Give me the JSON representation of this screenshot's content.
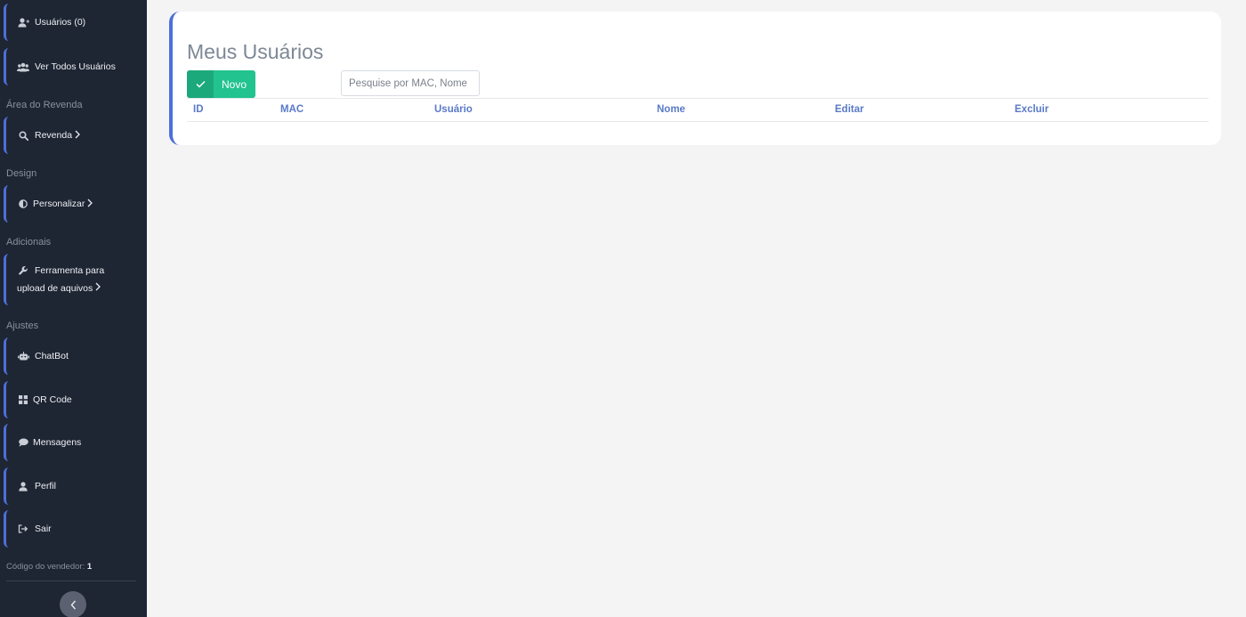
{
  "sidebar": {
    "items": {
      "usuarios": "Usuários (0)",
      "ver_todos": "Ver Todos Usuários",
      "revenda": "Revenda",
      "personalizar": "Personalizar",
      "ferramenta_line1": "Ferramenta para",
      "ferramenta_line2": "upload de aquivos",
      "chatbot": "ChatBot",
      "qrcode": "QR Code",
      "mensagens": "Mensagens",
      "perfil": "Perfil",
      "sair": "Sair"
    },
    "sections": {
      "area_revenda": "Área do Revenda",
      "design": "Design",
      "adicionais": "Adicionais",
      "ajustes": "Ajustes"
    },
    "vendor_label": "Código do vendedor:",
    "vendor_code": "1",
    "icons": [
      "user-plus-icon",
      "users-icon",
      "search-icon",
      "half-circle-icon",
      "wrench-icon",
      "robot-icon",
      "grid-icon",
      "chat-icon",
      "user-icon",
      "sign-out-icon",
      "chevron-left-icon"
    ]
  },
  "main": {
    "title": "Meus Usuários",
    "new_button": "Novo",
    "search_placeholder": "Pesquise por MAC, Nome",
    "table": {
      "columns": [
        "ID",
        "MAC",
        "Usuário",
        "Nome",
        "Editar",
        "Excluir"
      ],
      "rows": []
    }
  },
  "colors": {
    "sidebar_bg": "#1e2533",
    "accent": "#4e6fd8",
    "success": "#22c38e",
    "header_text": "#5a7ac8",
    "page_bg": "#f4f4f4"
  }
}
